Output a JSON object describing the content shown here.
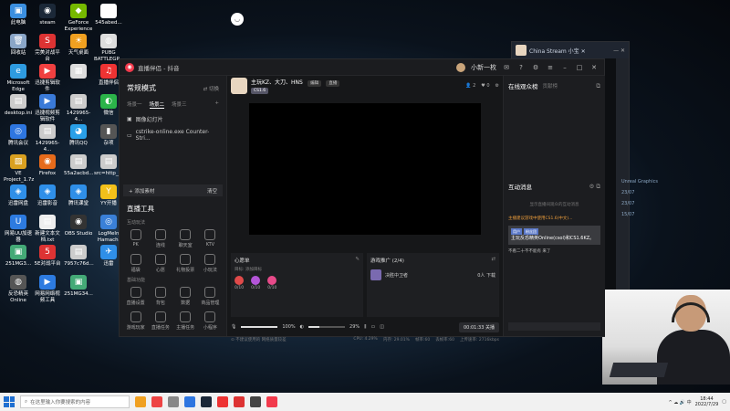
{
  "desktop": {
    "icons": [
      {
        "label": "此电脑",
        "color": "#3b8fe0",
        "glyph": "▣"
      },
      {
        "label": "steam",
        "color": "#1b2838",
        "glyph": "◉"
      },
      {
        "label": "GeForce Experience",
        "color": "#76b900",
        "glyph": "◆"
      },
      {
        "label": "545abed...",
        "color": "#ffffff",
        "glyph": "▤"
      },
      {
        "label": "回收站",
        "color": "#8aa6c8",
        "glyph": "🗑"
      },
      {
        "label": "完美对战平台",
        "color": "#d33",
        "glyph": "S"
      },
      {
        "label": "天气桌面",
        "color": "#f0a020",
        "glyph": "☀"
      },
      {
        "label": "PUBG BATTLEGR...",
        "color": "#ddd",
        "glyph": "◍"
      },
      {
        "label": "Microsoft Edge",
        "color": "#2e9be0",
        "glyph": "e"
      },
      {
        "label": "迅捷剪辑软件",
        "color": "#f04040",
        "glyph": "▶"
      },
      {
        "label": "",
        "color": "#ddd",
        "glyph": "▦"
      },
      {
        "label": "直播伴侣",
        "color": "#e33",
        "glyph": "♫"
      },
      {
        "label": "desktop.ini",
        "color": "#ccc",
        "glyph": "▤"
      },
      {
        "label": "迅捷视频剪辑软件",
        "color": "#3a7ad8",
        "glyph": "▶"
      },
      {
        "label": "1429965-4...",
        "color": "#ccc",
        "glyph": "▤"
      },
      {
        "label": "微信",
        "color": "#2bb44a",
        "glyph": "◐"
      },
      {
        "label": "腾讯会议",
        "color": "#2e76e0",
        "glyph": "◎"
      },
      {
        "label": "1429965-4...",
        "color": "#ccc",
        "glyph": "▤"
      },
      {
        "label": "腾讯QQ",
        "color": "#2aa0e8",
        "glyph": "◕"
      },
      {
        "label": "杂项",
        "color": "#555",
        "glyph": "▮"
      },
      {
        "label": "VE Project_1.7z",
        "color": "#d9a020",
        "glyph": "▧"
      },
      {
        "label": "Firefox",
        "color": "#e66b1b",
        "glyph": "◉"
      },
      {
        "label": "55a2acbd...",
        "color": "#ccc",
        "glyph": "▤"
      },
      {
        "label": "src=http__pic.962.n...",
        "color": "#ccc",
        "glyph": "▤"
      },
      {
        "label": "迅雷网盘",
        "color": "#2f8fe8",
        "glyph": "◈"
      },
      {
        "label": "迅雷影音",
        "color": "#2f8fe8",
        "glyph": "◈"
      },
      {
        "label": "腾讯课堂",
        "color": "#2f8fe8",
        "glyph": "◈"
      },
      {
        "label": "YY开播",
        "color": "#f2c01a",
        "glyph": "Y"
      },
      {
        "label": "网易UU加速器",
        "color": "#2d7be0",
        "glyph": "U"
      },
      {
        "label": "新建文本文档.txt",
        "color": "#eee",
        "glyph": "▤"
      },
      {
        "label": "OBS Studio",
        "color": "#333",
        "glyph": "◉"
      },
      {
        "label": "LogMeIn Hamachi",
        "color": "#3a80d8",
        "glyph": "◎"
      },
      {
        "label": "251MG3...",
        "color": "#4a7",
        "glyph": "▣"
      },
      {
        "label": "5E对战平台",
        "color": "#d33",
        "glyph": "5"
      },
      {
        "label": "7957c76d...",
        "color": "#ccc",
        "glyph": "▤"
      },
      {
        "label": "迅雷",
        "color": "#2f8fe8",
        "glyph": "✈"
      },
      {
        "label": "反恐精英 Online",
        "color": "#555",
        "glyph": "◍"
      },
      {
        "label": "网易网络视频工具",
        "color": "#2d7be0",
        "glyph": "▶"
      },
      {
        "label": "251MG34...",
        "color": "#4a7",
        "glyph": "▣"
      }
    ]
  },
  "app": {
    "title": "直播伴侣 - 抖音",
    "username": "小新一枚",
    "left": {
      "mode": "常规模式",
      "switch_label": "⇄ 切换",
      "scene_tabs": [
        "场景一",
        "场景二",
        "场景三"
      ],
      "sources": [
        {
          "icon": "▣",
          "label": "图像幻灯片"
        },
        {
          "icon": "▭",
          "label": "cstrike-online.exe Counter-Stri..."
        }
      ],
      "add_source": "+ 添加素材",
      "clear": "清空",
      "tools_title": "直播工具",
      "tool_section1": "互动玩法",
      "tools1": [
        "PK",
        "连线",
        "聊天室",
        "KTV",
        "福袋",
        "心愿",
        "礼物投票",
        "小玩法"
      ],
      "tool_section2": "基础功能",
      "tools2": [
        "直播设置",
        "背包",
        "数据",
        "商品管理",
        "游戏玩家",
        "直播任务",
        "主播任务",
        "小程序"
      ]
    },
    "center": {
      "streamer_name": "主玩KZ、大刀、HNS",
      "tag_self": "编辑",
      "tag_room": "直播",
      "game_tag": "CS1.6",
      "viewer_stats": [
        "👤 2",
        "♥ 0"
      ],
      "card1_title": "心愿单",
      "card1_sub": "目标: 添加目标",
      "gifts": [
        {
          "label": "0/10",
          "color": "#e04a4a"
        },
        {
          "label": "0/10",
          "color": "#b455d8"
        },
        {
          "label": "0/10",
          "color": "#e84a8a"
        }
      ],
      "card2_title": "游戏推广 (2/4)",
      "promo_game": "决胜中卫者",
      "promo_count": "0人 下载",
      "mic_vol": "100%",
      "speaker_vol": "29%",
      "mic_fill": 1.0,
      "speaker_fill": 0.29,
      "timer_btn": "00:01:33 关播",
      "status_left": "⊙ 不建议使用的 网络质量较差",
      "status_items": [
        "CPU: 4.29%",
        "内存: 29.01%",
        "帧率:60",
        "丢帧率:60",
        "上传速率: 2716kbps"
      ]
    },
    "right": {
      "viewers_title": "在线观众榜",
      "viewers_tab2": "贡献榜",
      "chat_title": "互动消息",
      "chat_empty": "显示直播间观众的互动消息",
      "chat_orange": "主播建议游戏中使用CS1.6(中文)...",
      "chat_msg": "主玩反恐精英Online(csol)和CS1.6KZ。",
      "chat_tags": [
        "用户",
        "粉丝团"
      ],
      "chat_note": "不看二十不不能有 来了"
    }
  },
  "china_stream": {
    "title": "China Stream 小宝 ✕",
    "graphic_lines": [
      "Unreal Graphics",
      "23/07",
      "23/07",
      "15/07"
    ]
  },
  "taskbar": {
    "search_placeholder": "在这里输入你要搜索的内容",
    "time": "18:44",
    "date": "2022/7/29",
    "apps": [
      "#f0a020",
      "#e44",
      "#888",
      "#2e76e0",
      "#1b2838",
      "#e33",
      "#d33",
      "#444",
      "#f23a4c"
    ]
  }
}
